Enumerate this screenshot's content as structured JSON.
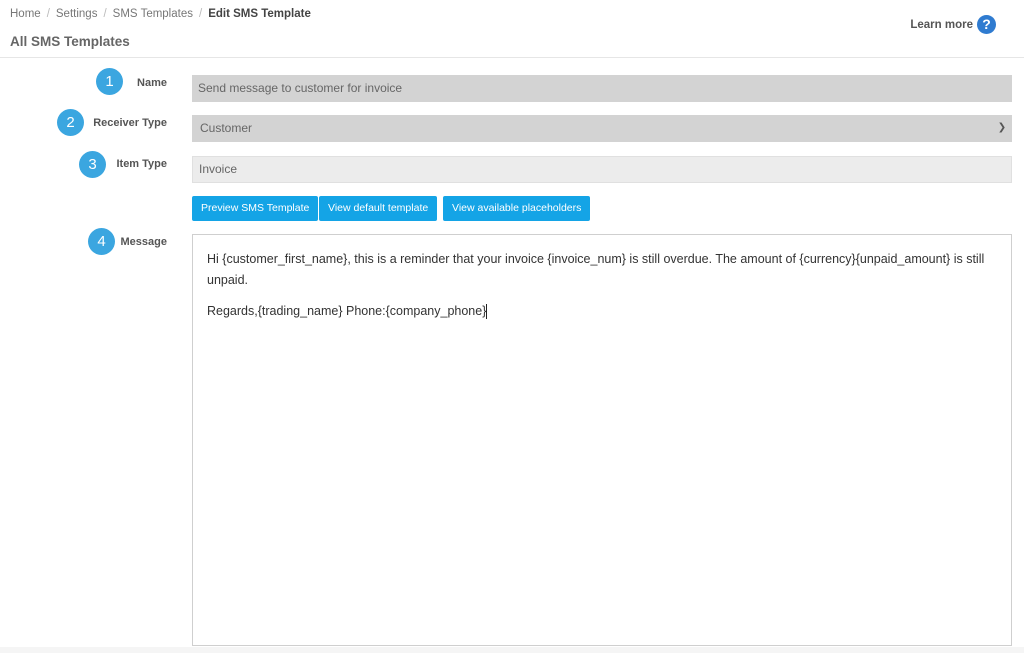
{
  "header": {
    "breadcrumb": [
      "Home",
      "Settings",
      "SMS Templates",
      "Edit SMS Template"
    ],
    "title": "All SMS Templates",
    "learn_more": "Learn more",
    "help_icon": "question-circle-icon"
  },
  "form": {
    "name": {
      "step": "1",
      "label": "Name",
      "value": "Send message to customer for invoice"
    },
    "receiver_type": {
      "step": "2",
      "label": "Receiver Type",
      "value": "Customer"
    },
    "item_type": {
      "step": "3",
      "label": "Item Type",
      "value": "Invoice"
    },
    "buttons": {
      "preview": "Preview SMS Template",
      "view_default": "View default template",
      "view_placeholders": "View available placeholders"
    },
    "message": {
      "step": "4",
      "label": "Message",
      "line1": "Hi {customer_first_name}, this is a reminder that your invoice {invoice_num} is still overdue. The amount of {currency}{unpaid_amount} is still unpaid.",
      "line2": "Regards,{trading_name} Phone:{company_phone}"
    }
  },
  "colors": {
    "accent": "#14a4e6",
    "badge": "#3ba6e0",
    "help": "#2f7bd0"
  }
}
